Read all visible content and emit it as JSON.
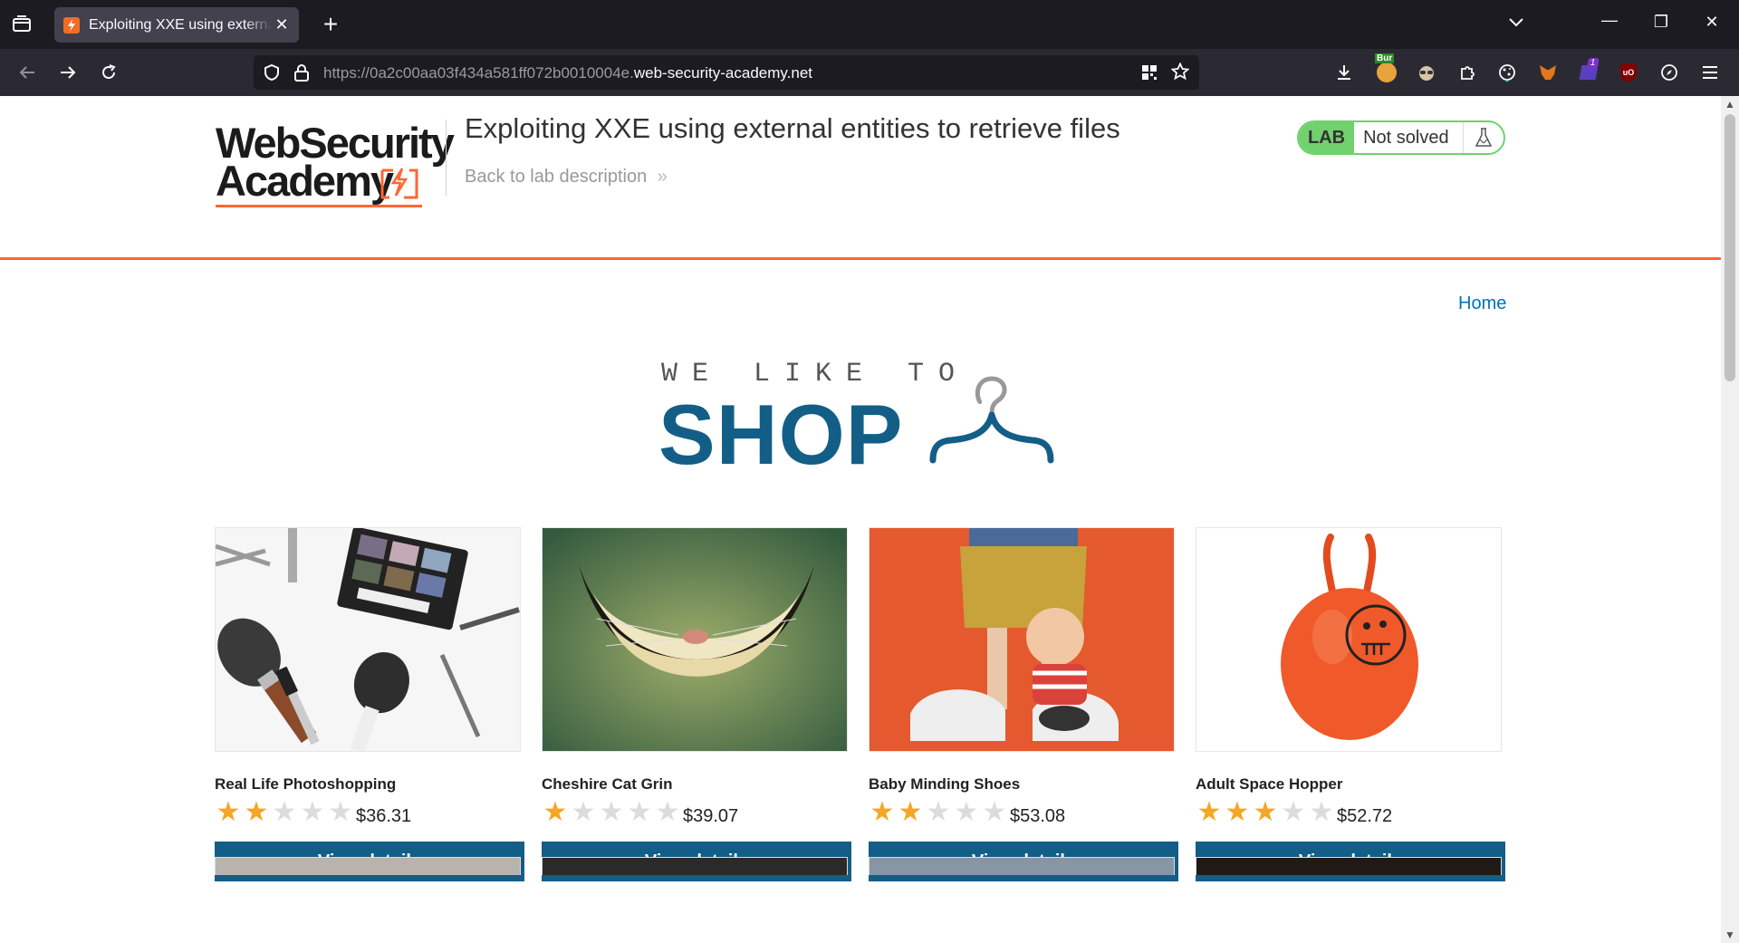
{
  "browser": {
    "tab_title": "Exploiting XXE using external entities to retrieve files",
    "tab_close": "✕",
    "new_tab": "+",
    "url_prefix": "https://0a2c00aa03f434a581ff072b0010004e.",
    "url_domain": "web-security-academy.net",
    "extensions": {
      "burp_badge": "Bur",
      "notification_count": "1",
      "ublock": "uO"
    },
    "window_controls": {
      "minimize": "—",
      "restore": "❐",
      "close": "✕"
    }
  },
  "header": {
    "logo_line1": "WebSecurity",
    "logo_line2": "Academy",
    "lab_title": "Exploiting XXE using external entities to retrieve files",
    "back_link": "Back to lab description",
    "back_chevrons": "»",
    "lab_badge": "LAB",
    "lab_status": "Not solved"
  },
  "nav": {
    "home": "Home"
  },
  "hero": {
    "tagline": "WE LIKE TO",
    "title": "SHOP"
  },
  "products": [
    {
      "name": "Real Life Photoshopping",
      "rating": 2,
      "price": "$36.31",
      "button": "View details"
    },
    {
      "name": "Cheshire Cat Grin",
      "rating": 1,
      "price": "$39.07",
      "button": "View details"
    },
    {
      "name": "Baby Minding Shoes",
      "rating": 2,
      "price": "$53.08",
      "button": "View details"
    },
    {
      "name": "Adult Space Hopper",
      "rating": 3,
      "price": "$52.72",
      "button": "View details"
    }
  ],
  "colors": {
    "accent": "#ff6633",
    "primary": "#135e86",
    "link": "#0071bc",
    "lab_green": "#70d16d",
    "star": "#f5a623"
  }
}
